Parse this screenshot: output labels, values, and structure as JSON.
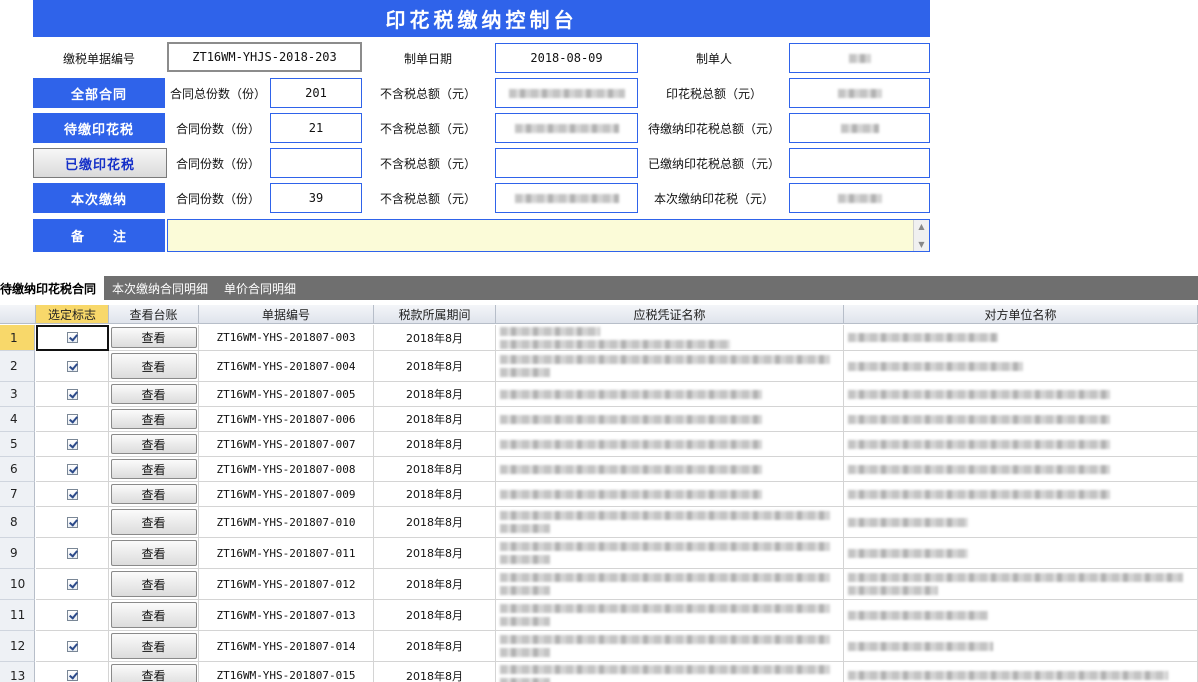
{
  "title": "印花税缴纳控制台",
  "header": {
    "doc_no_label": "缴税单据编号",
    "doc_no": "ZT16WM-YHJS-2018-203",
    "date_label": "制单日期",
    "date": "2018-08-09",
    "maker_label": "制单人"
  },
  "sections": [
    {
      "btn": "全部合同",
      "count_label": "合同总份数（份）",
      "count": "201",
      "amount_label": "不含税总额（元）",
      "tax_label": "印花税总额（元）"
    },
    {
      "btn": "待缴印花税",
      "count_label": "合同份数（份）",
      "count": "21",
      "amount_label": "不含税总额（元）",
      "tax_label": "待缴纳印花税总额（元）"
    },
    {
      "btn": "已缴印花税",
      "count_label": "合同份数（份）",
      "count": "",
      "amount_label": "不含税总额（元）",
      "tax_label": "已缴纳印花税总额（元）"
    },
    {
      "btn": "本次缴纳",
      "count_label": "合同份数（份）",
      "count": "39",
      "amount_label": "不含税总额（元）",
      "tax_label": "本次缴纳印花税（元）"
    }
  ],
  "remark_label": "备　　注",
  "tabs": [
    "待缴纳印花税合同",
    "本次缴纳合同明细",
    "单价合同明细"
  ],
  "columns": [
    "选定标志",
    "查看台账",
    "单据编号",
    "税款所属期间",
    "应税凭证名称",
    "对方单位名称"
  ],
  "view_label": "查看",
  "rows": [
    {
      "n": "1",
      "doc": "ZT16WM-YHS-201807-003",
      "period": "2018年8月"
    },
    {
      "n": "2",
      "doc": "ZT16WM-YHS-201807-004",
      "period": "2018年8月"
    },
    {
      "n": "3",
      "doc": "ZT16WM-YHS-201807-005",
      "period": "2018年8月"
    },
    {
      "n": "4",
      "doc": "ZT16WM-YHS-201807-006",
      "period": "2018年8月"
    },
    {
      "n": "5",
      "doc": "ZT16WM-YHS-201807-007",
      "period": "2018年8月"
    },
    {
      "n": "6",
      "doc": "ZT16WM-YHS-201807-008",
      "period": "2018年8月"
    },
    {
      "n": "7",
      "doc": "ZT16WM-YHS-201807-009",
      "period": "2018年8月"
    },
    {
      "n": "8",
      "doc": "ZT16WM-YHS-201807-010",
      "period": "2018年8月"
    },
    {
      "n": "9",
      "doc": "ZT16WM-YHS-201807-011",
      "period": "2018年8月"
    },
    {
      "n": "10",
      "doc": "ZT16WM-YHS-201807-012",
      "period": "2018年8月"
    },
    {
      "n": "11",
      "doc": "ZT16WM-YHS-201807-013",
      "period": "2018年8月"
    },
    {
      "n": "12",
      "doc": "ZT16WM-YHS-201807-014",
      "period": "2018年8月"
    },
    {
      "n": "13",
      "doc": "ZT16WM-YHS-201807-015",
      "period": "2018年8月"
    }
  ]
}
